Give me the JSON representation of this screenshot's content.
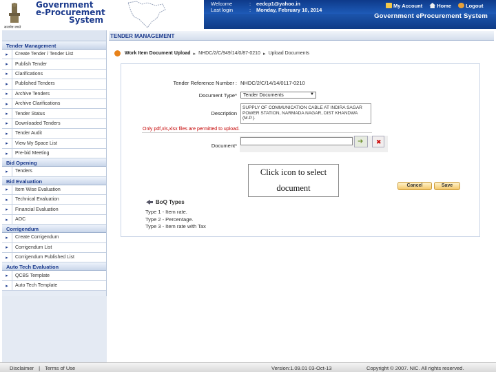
{
  "header": {
    "logo_line1": "Government",
    "logo_line2": "e-Procurement",
    "logo_line3": "System",
    "emblem_caption": "सत्यमेव जयते",
    "welcome_label": "Welcome",
    "welcome_value": "eedcp1@yahoo.in",
    "last_login_label": "Last login",
    "last_login_value": "Monday, February 10, 2014",
    "links": [
      "My Account",
      "Home",
      "Logout"
    ],
    "system_title": "Government eProcurement System"
  },
  "sidebar": {
    "sections": [
      {
        "title": "Tender Management",
        "items": [
          "Create Tender / Tender List",
          "Publish Tender",
          "Clarifications",
          "Published Tenders",
          "Archive Tenders",
          "Archive Clarifications",
          "Tender Status",
          "Downloaded Tenders",
          "Tender Audit",
          "View My Space List",
          "Pre-bid Meeting"
        ]
      },
      {
        "title": "Bid Opening",
        "items": [
          "Tenders"
        ]
      },
      {
        "title": "Bid Evaluation",
        "items": [
          "Item Wise Evaluation",
          "Technical Evaluation",
          "Financial Evaluation",
          "AOC"
        ]
      },
      {
        "title": "Corrigendum",
        "items": [
          "Create Corrigendum",
          "Corrigendum List",
          "Corrigendum Published List"
        ]
      },
      {
        "title": "Auto Tech Evaluation",
        "items": [
          "QCBS Template",
          "Auto Tech Template"
        ]
      }
    ]
  },
  "page": {
    "section_title": "TENDER MANAGEMENT",
    "breadcrumb": [
      "Work Item Document Upload",
      "NHDC/2/C/949/14/0/87-0210",
      "Upload Documents"
    ],
    "form": {
      "tender_ref_label": "Tender Reference Number :",
      "tender_ref_value": "NHDC/2/C/14/14/0117-0210",
      "doc_type_label": "Document Type*",
      "doc_type_value": "Tender Documents",
      "description_label": "Description",
      "description_value": "SUPPLY OF COMMUNICATION CABLE AT INDIRA SAGAR POWER STATION, NARMADA NAGAR, DIST KHANDWA (M.P.).",
      "hint": "Only pdf,xls,xlsx files are permitted to upload.",
      "document_label": "Document*",
      "document_value": ""
    },
    "callout_line1": "Click icon to select",
    "callout_line2": "document",
    "cancel_label": "Cancel",
    "save_label": "Save",
    "boq": {
      "title": "BoQ Types",
      "lines": [
        "Type 1 - Item rate.",
        "Type 2 - Percentage.",
        "Type 3 - Item rate with Tax"
      ]
    }
  },
  "footer": {
    "disclaimer": "Disclaimer",
    "separator": "|",
    "terms": "Terms of Use",
    "version": "Version:1.09.01 03-Oct-13",
    "copyright": "Copyright © 2007. NIC. All rights reserved."
  },
  "colors": {
    "header_blue": "#1e5bb8",
    "logo_blue": "#1b3a8c",
    "hint_red": "#c40000",
    "breadcrumb_orange": "#e8821a"
  }
}
